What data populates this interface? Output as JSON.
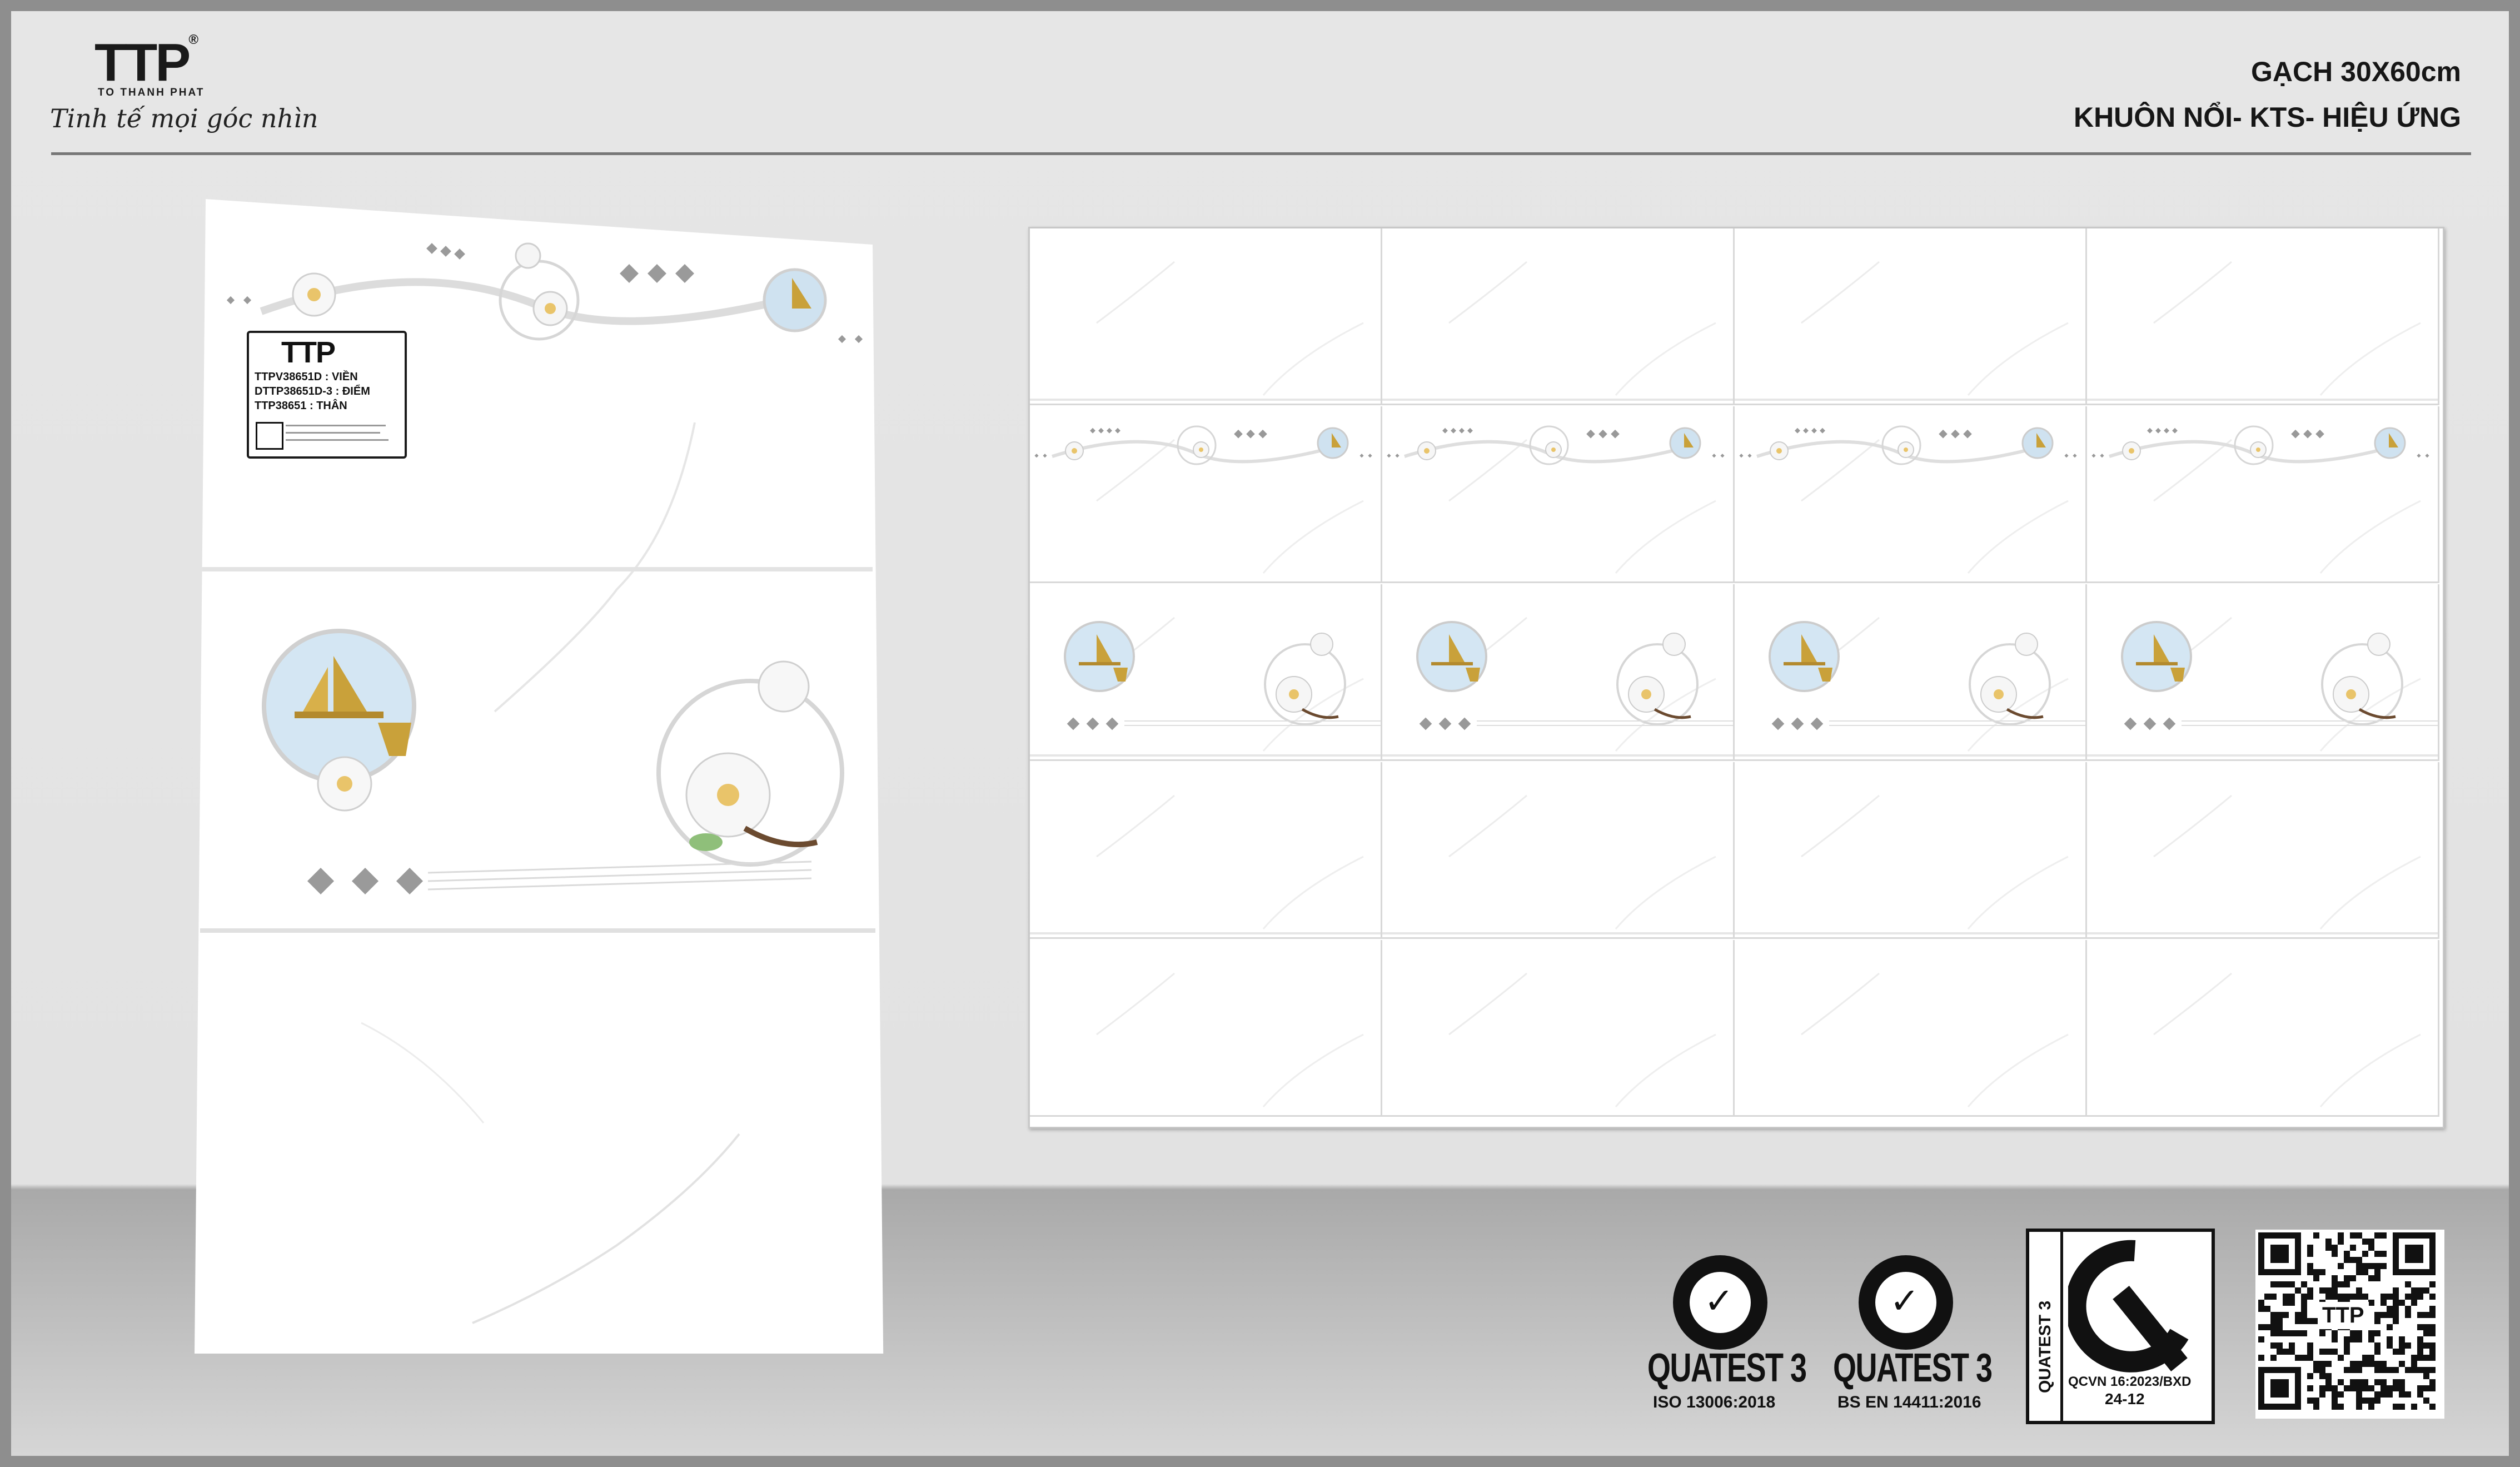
{
  "brand": {
    "logo_text": "TTP",
    "registered_mark": "®",
    "company_name": "TO THANH PHAT",
    "tagline": "Tinh tế mọi góc nhìn"
  },
  "header": {
    "title_line1": "GẠCH 30X60cm",
    "title_line2": "KHUÔN NỔI- KTS- HIỆU ỨNG"
  },
  "product_label": {
    "logo": "TTP",
    "codes": [
      {
        "code": "TTPV38651D",
        "sep": ":",
        "type": "VIỀN"
      },
      {
        "code": "DTTP38651D-3",
        "sep": ":",
        "type": "ĐIỂM"
      },
      {
        "code": "TTP38651",
        "sep": ":",
        "type": "THÂN"
      }
    ]
  },
  "certifications": [
    {
      "name": "QUATEST 3",
      "standard": "ISO 13006:2018"
    },
    {
      "name": "QUATEST 3",
      "standard": "BS EN 14411:2016"
    },
    {
      "name": "QUATEST 3",
      "standard": "QCVN 16:2023/BXD",
      "sub": "24-12"
    }
  ],
  "qr": {
    "label": "TTP"
  },
  "icons": [
    "lotus-flower-icon",
    "sailboat-icon",
    "deer-icon",
    "diamond-ornament-icon",
    "cr-mark-icon",
    "quatest-check-icon",
    "qr-code-icon"
  ],
  "colors": {
    "tile": "#ffffff",
    "background": "#e4e4e4",
    "floor": "#b0b0b0",
    "text": "#161616"
  }
}
